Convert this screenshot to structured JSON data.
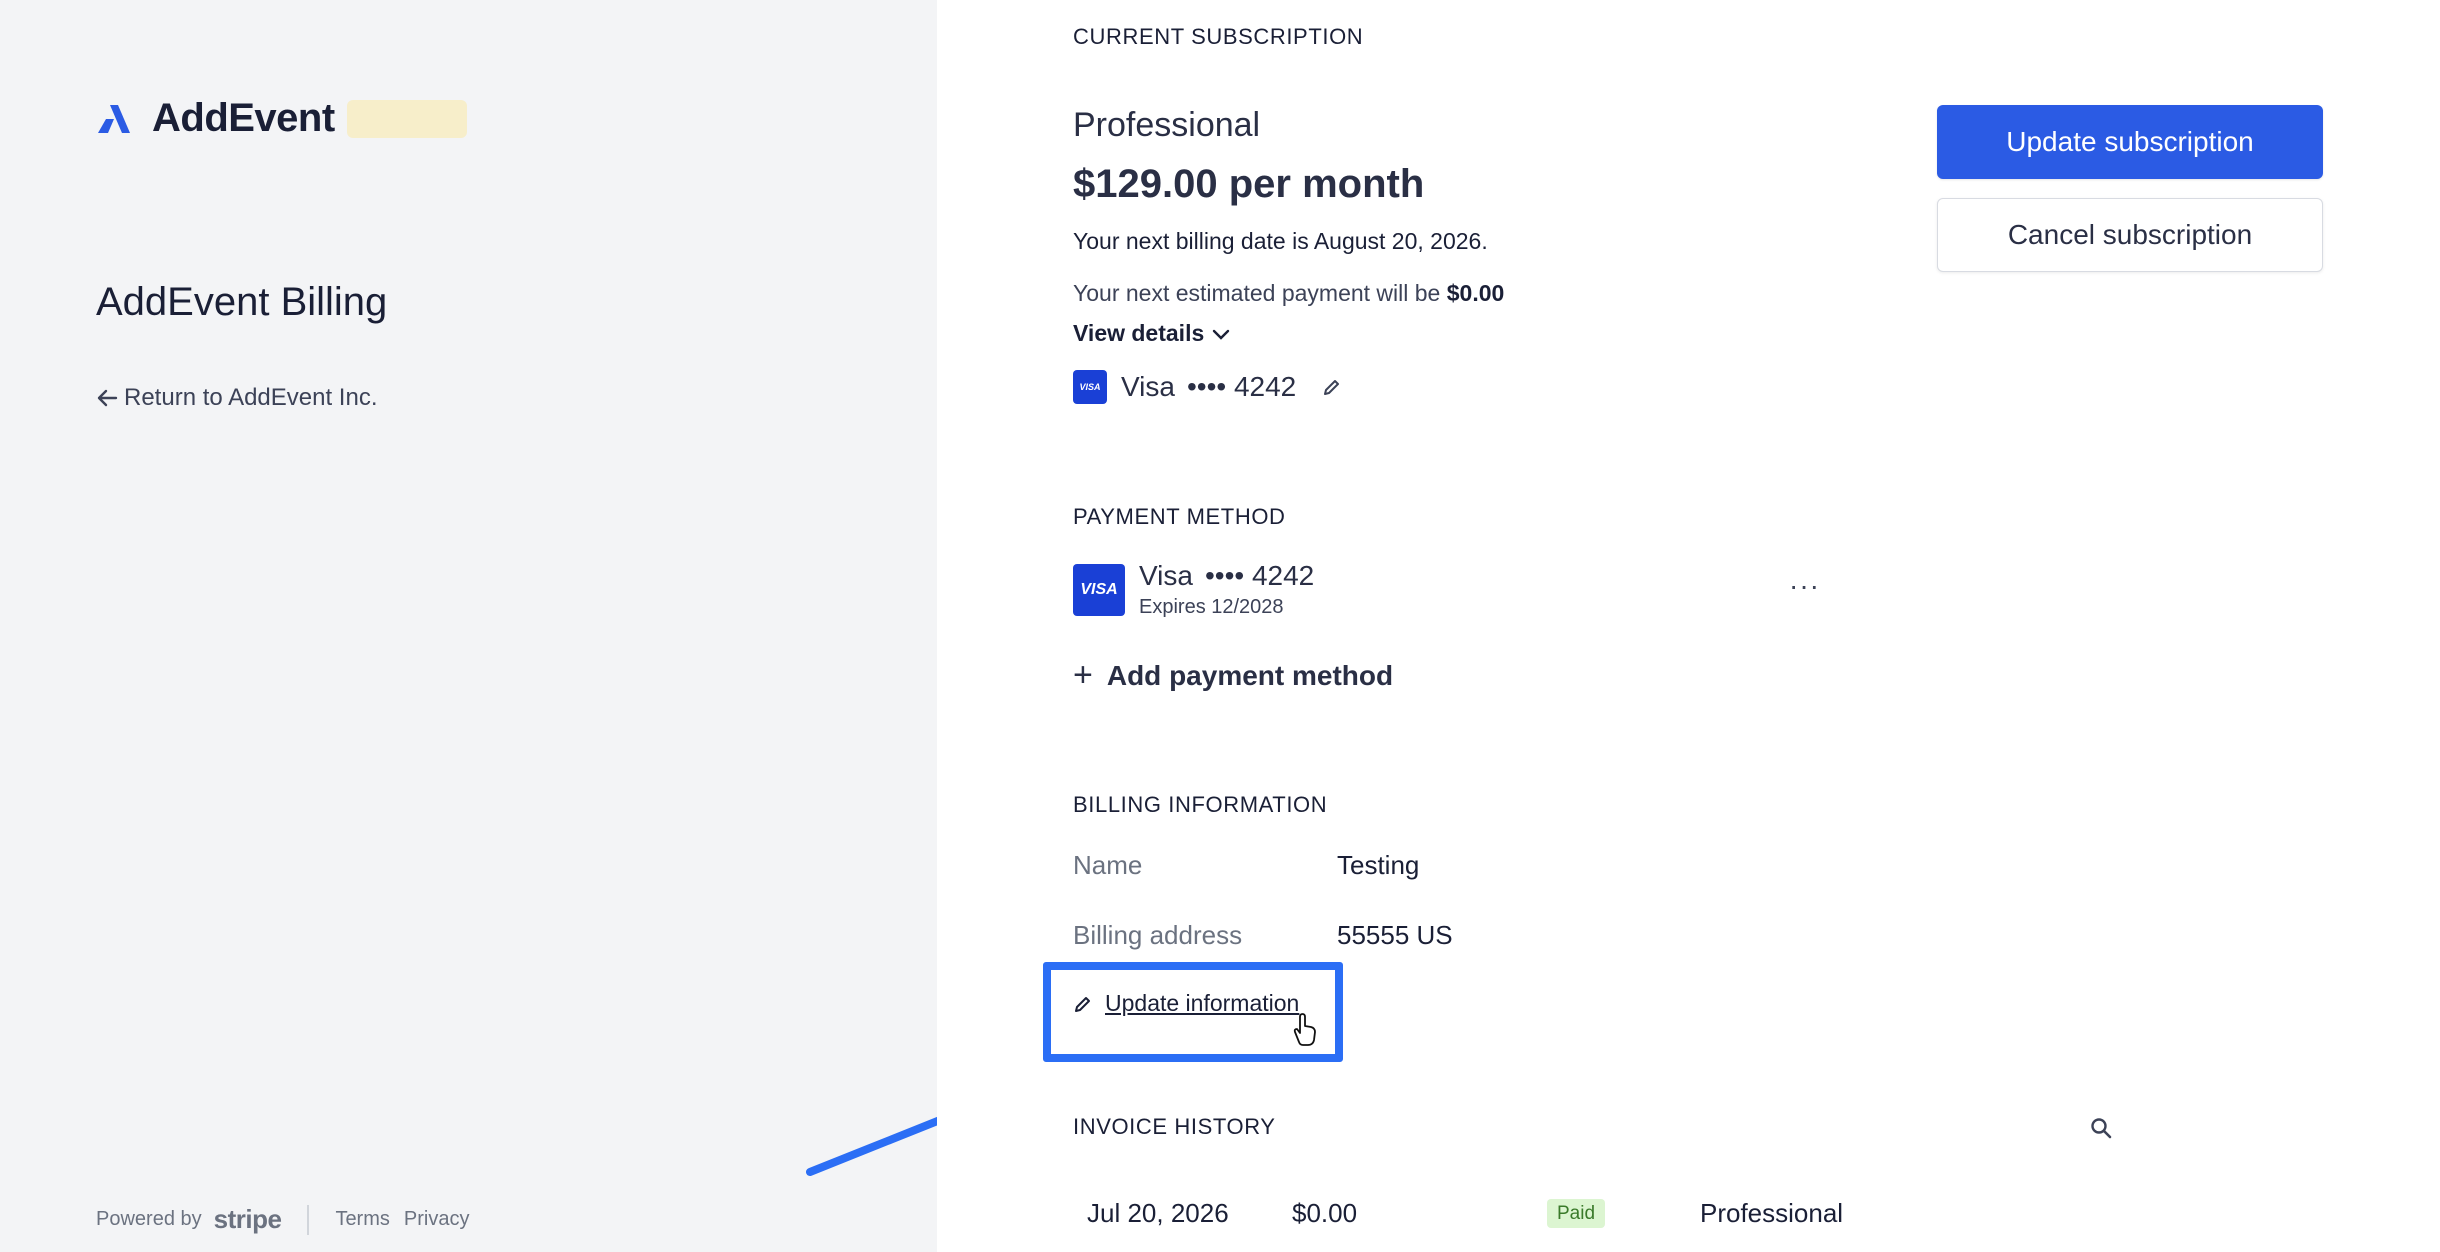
{
  "brand": {
    "name": "AddEvent",
    "logo_icon": "addevent-logo-icon",
    "accent_color": "#2b5be4"
  },
  "left": {
    "title": "AddEvent Billing",
    "return_link": "Return to AddEvent Inc.",
    "footer": {
      "powered_by": "Powered by",
      "stripe": "stripe",
      "terms": "Terms",
      "privacy": "Privacy"
    }
  },
  "subscription": {
    "heading": "CURRENT SUBSCRIPTION",
    "plan": "Professional",
    "price": "$129.00 per month",
    "next_billing": "Your next billing date is August 20, 2026.",
    "next_payment_prefix": "Your next estimated payment will be",
    "next_payment_amount": "$0.00",
    "view_details": "View details",
    "card_brand": "Visa",
    "card_number": "•••• 4242",
    "update_button": "Update subscription",
    "cancel_button": "Cancel subscription"
  },
  "payment_method": {
    "heading": "PAYMENT METHOD",
    "card_brand": "Visa",
    "card_number": "•••• 4242",
    "expires": "Expires 12/2028",
    "badge_text": "VISA",
    "more": "···",
    "add_label": "Add payment method"
  },
  "billing_info": {
    "heading": "BILLING INFORMATION",
    "name_label": "Name",
    "name_value": "Testing",
    "address_label": "Billing address",
    "address_value": "55555 US",
    "update_label": "Update information"
  },
  "invoice_history": {
    "heading": "INVOICE HISTORY",
    "rows": [
      {
        "date": "Jul 20, 2026",
        "amount": "$0.00",
        "status": "Paid",
        "plan": "Professional"
      }
    ]
  },
  "annotation": {
    "highlight_color": "#2b6ef5",
    "arrow_color": "#2b6ef5"
  }
}
